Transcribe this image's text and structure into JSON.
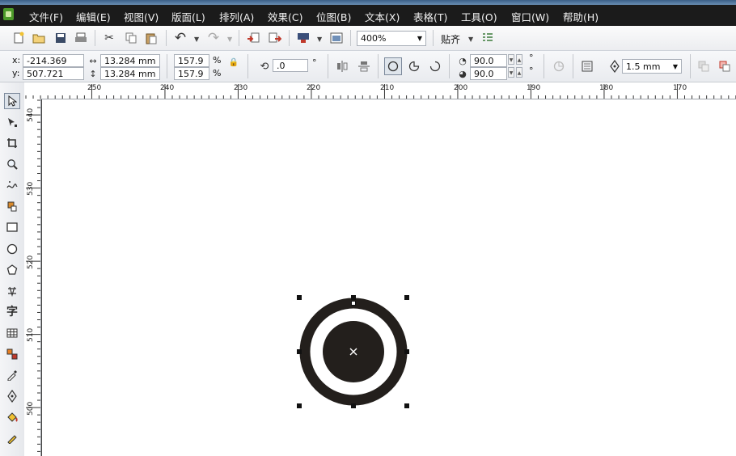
{
  "menu": {
    "items": [
      "文件(F)",
      "编辑(E)",
      "视图(V)",
      "版面(L)",
      "排列(A)",
      "效果(C)",
      "位图(B)",
      "文本(X)",
      "表格(T)",
      "工具(O)",
      "窗口(W)",
      "帮助(H)"
    ]
  },
  "toolbar": {
    "zoom": "400%",
    "snap_label": "贴齐"
  },
  "properties": {
    "x_label": "x:",
    "x_value": "-214.369 mm",
    "y_label": "y:",
    "y_value": "507.721 mm",
    "width_value": "13.284 mm",
    "height_value": "13.284 mm",
    "scale_x": "157.9",
    "scale_y": "157.9",
    "percent": "%",
    "rotation": ".0",
    "degree": "°",
    "start_angle": "90.0",
    "end_angle": "90.0",
    "outline_width": "1.5 mm"
  },
  "ruler": {
    "h_labels": [
      "250",
      "240",
      "230",
      "220",
      "210",
      "200",
      "190",
      "180",
      "170"
    ],
    "v_labels": [
      "540",
      "530",
      "520",
      "510",
      "500"
    ]
  },
  "icons": {
    "app": "coreldraw-app-icon",
    "new": "new-document-icon",
    "open": "open-folder-icon",
    "save": "save-icon",
    "print": "print-icon",
    "cut": "scissors-icon",
    "copy": "copy-icon",
    "paste": "paste-icon",
    "undo": "undo-icon",
    "redo": "redo-icon",
    "import": "import-icon",
    "export": "export-icon",
    "launcher": "application-launcher-icon",
    "welcome": "welcome-screen-icon",
    "snap_options": "snap-options-icon"
  },
  "colors": {
    "menubar": "#1b1b1b",
    "shape_fill": "#231f1c",
    "selection_handle": "#111111"
  }
}
